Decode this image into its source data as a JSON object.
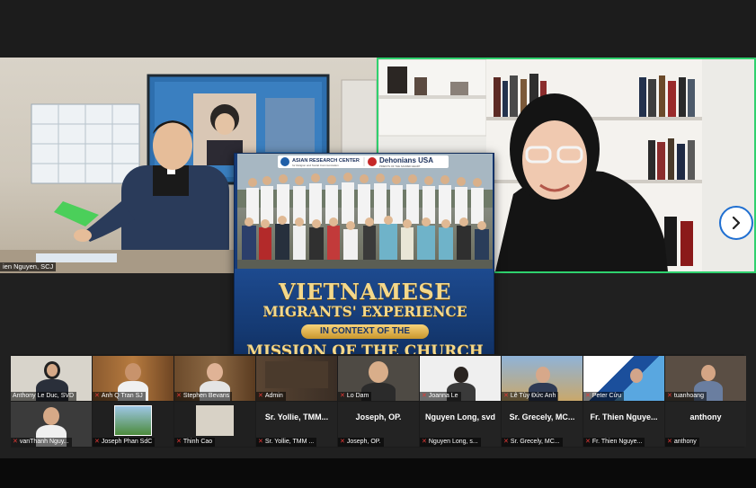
{
  "speakers": {
    "left_name": "ien Nguyen, SCJ"
  },
  "poster": {
    "logo_left": "ASIAN RESEARCH CENTER",
    "logo_left_sub": "for Religion and Social Communication",
    "logo_right": "Dehonians USA",
    "logo_right_sub": "PRIESTS OF THE SACRED HEART",
    "line1": "VIETNAMESE",
    "line2": "MIGRANTS' EXPERIENCE",
    "line3": "IN CONTEXT OF THE",
    "line4": "MISSION OF THE CHURCH"
  },
  "controls": {
    "next_icon": "chevron-right-icon"
  },
  "gallery": {
    "row1": [
      {
        "label": "Anthony Le Duc, SVD",
        "muted": false
      },
      {
        "label": "Anh Q Tran SJ",
        "muted": true
      },
      {
        "label": "Stephen Bevans",
        "muted": true
      },
      {
        "label": "Admin",
        "muted": true
      },
      {
        "label": "Lo Dam",
        "muted": true
      },
      {
        "label": "Joanna Le",
        "muted": true
      },
      {
        "label": "Lê Tùy Đức Anh",
        "muted": true
      },
      {
        "label": "Peter Cửu",
        "muted": true
      },
      {
        "label": "tuanhoang",
        "muted": true
      }
    ],
    "row2": [
      {
        "label": "vanThanh Nguy...",
        "muted": true,
        "big": ""
      },
      {
        "label": "Joseph Phan SdC",
        "muted": true,
        "big": ""
      },
      {
        "label": "Thinh Cao",
        "muted": true,
        "big": ""
      },
      {
        "label": "Sr. Yollie, TMM ...",
        "muted": true,
        "big": "Sr. Yollie, TMM..."
      },
      {
        "label": "Joseph, OP.",
        "muted": true,
        "big": "Joseph, OP."
      },
      {
        "label": "Nguyen Long, s...",
        "muted": true,
        "big": "Nguyen Long, svd"
      },
      {
        "label": "Sr. Grecely, MC...",
        "muted": true,
        "big": "Sr. Grecely, MC..."
      },
      {
        "label": "Fr. Thien Nguye...",
        "muted": true,
        "big": "Fr. Thien Nguye..."
      },
      {
        "label": "anthony",
        "muted": true,
        "big": "anthony"
      }
    ]
  },
  "colors": {
    "active_speaker_border": "#2fd16e",
    "mute_red": "#e53935",
    "poster_gold": "#f4d88a",
    "poster_blue": "#163b78"
  }
}
